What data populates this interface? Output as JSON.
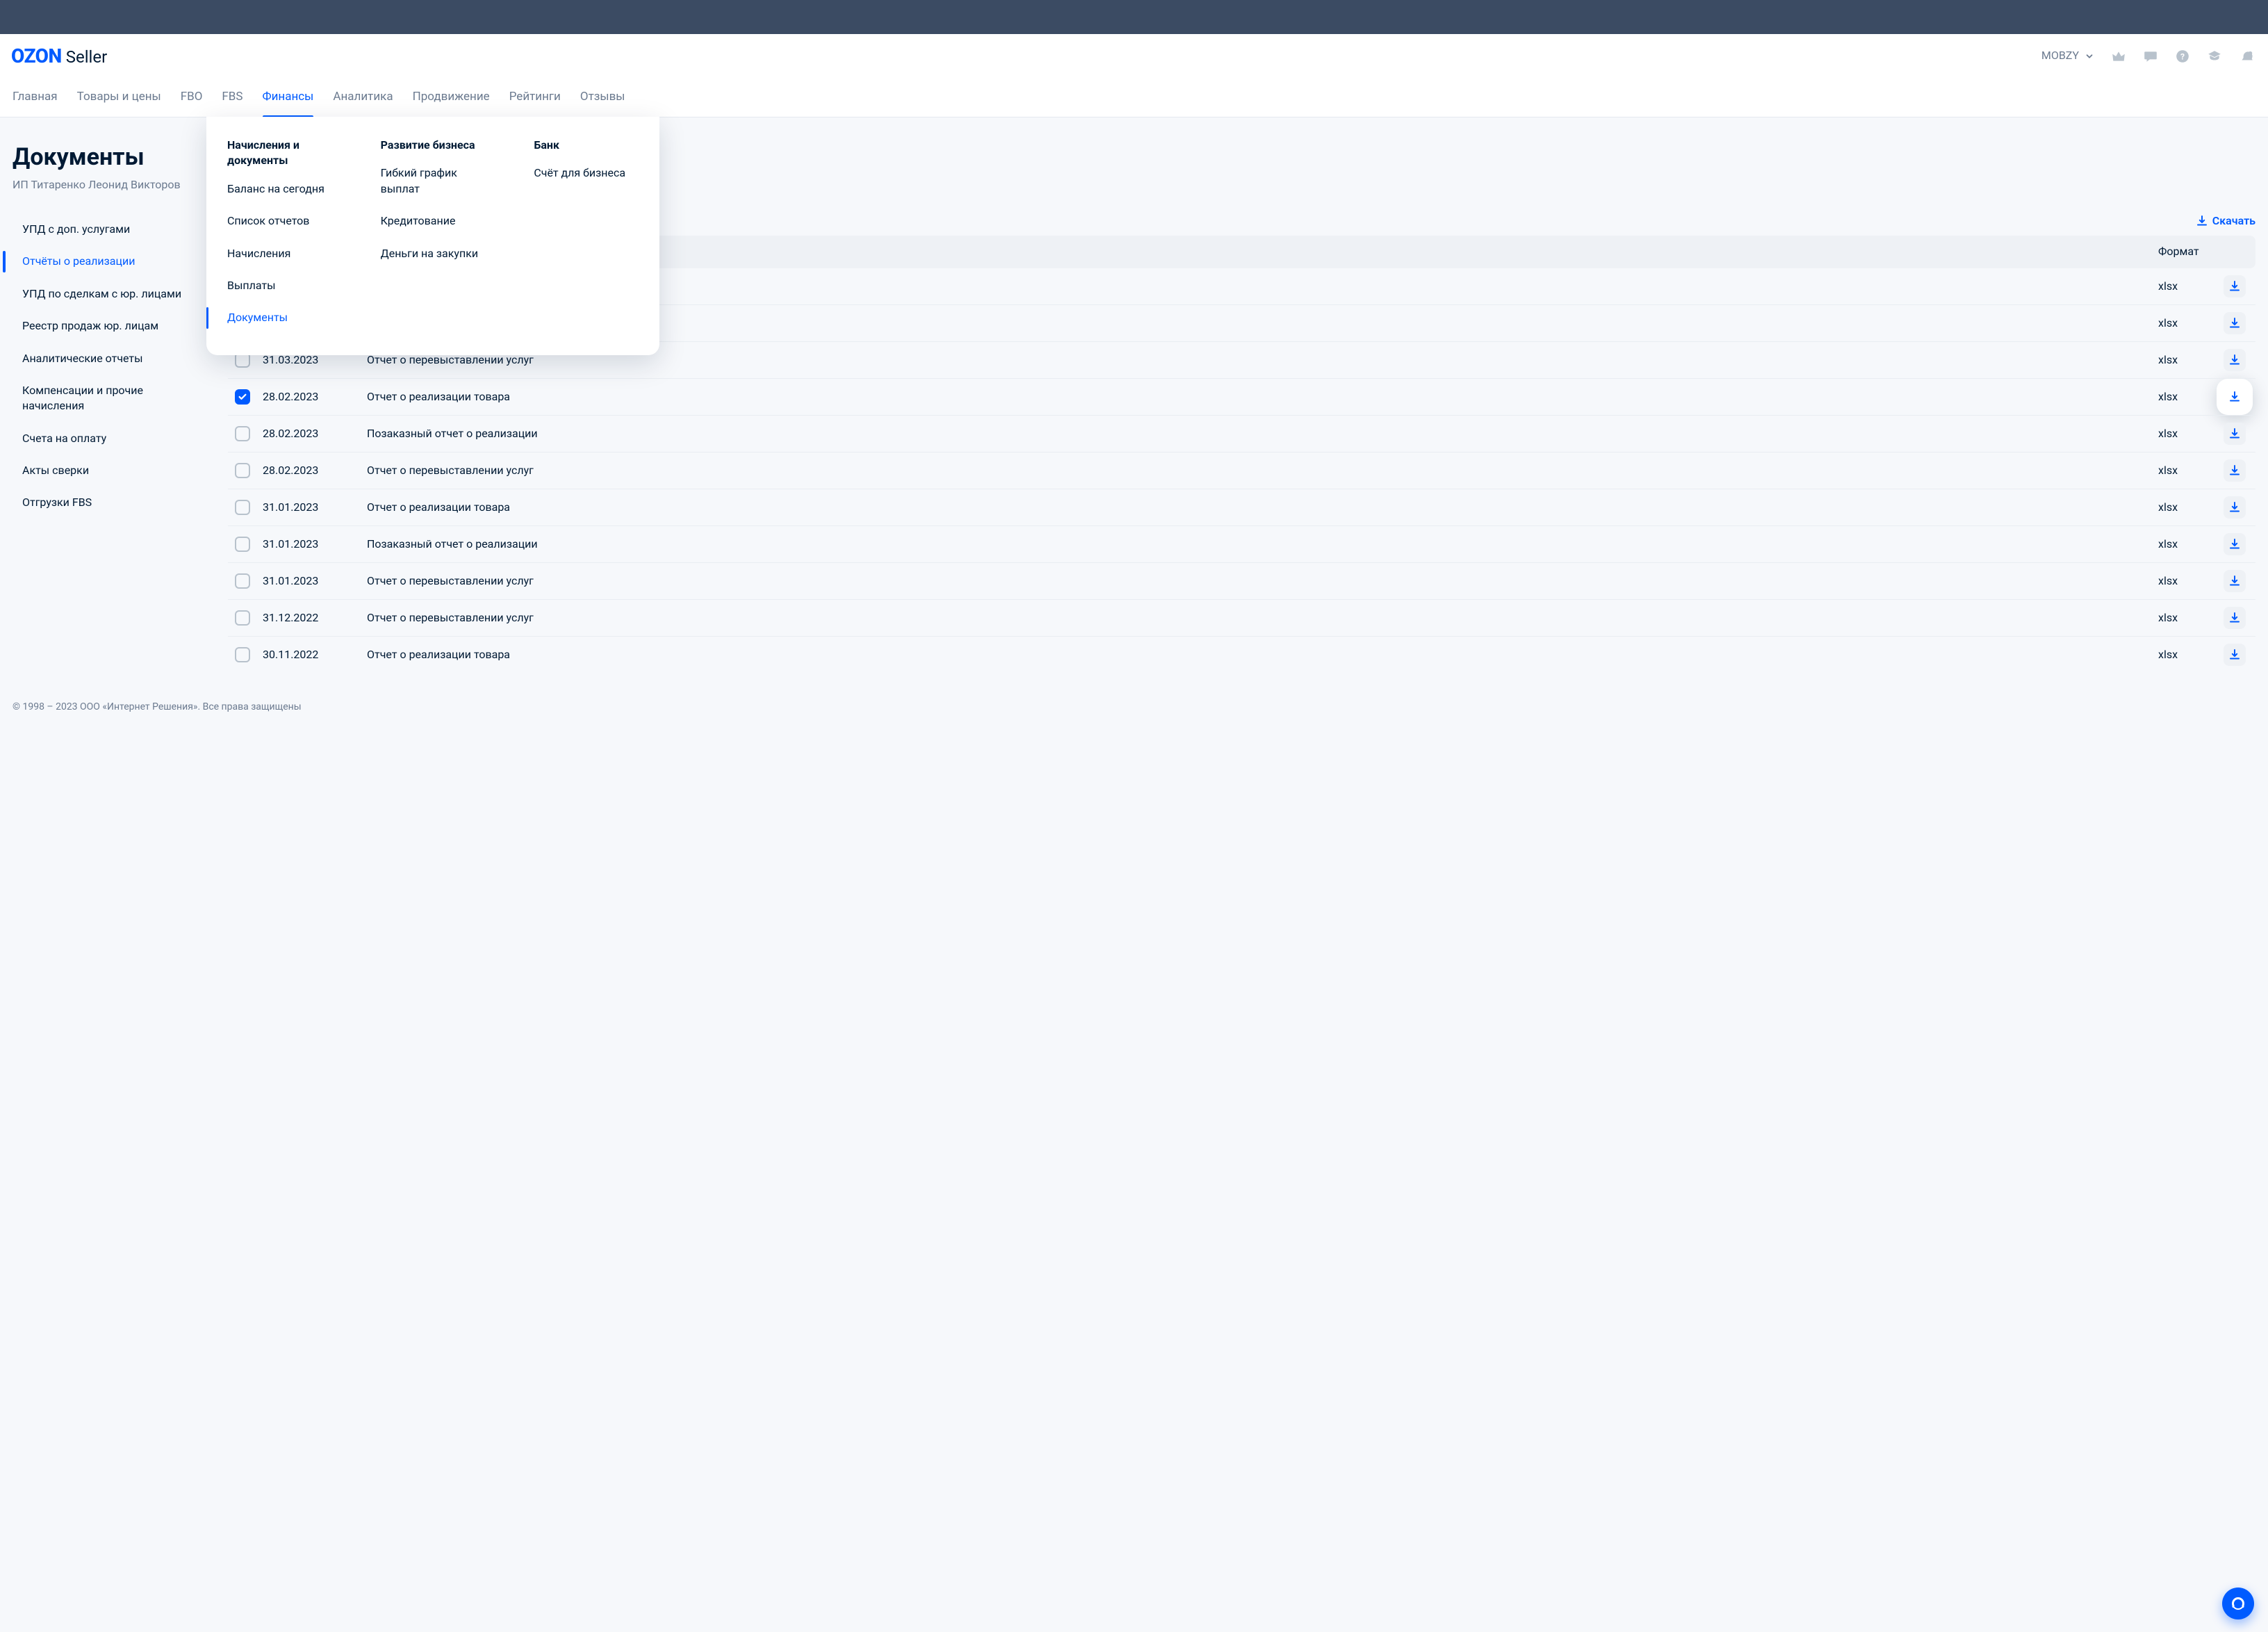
{
  "brand": {
    "main": "OZON",
    "sub": "Seller"
  },
  "account": "MOBZY",
  "nav": [
    {
      "label": "Главная"
    },
    {
      "label": "Товары и цены"
    },
    {
      "label": "FBO"
    },
    {
      "label": "FBS"
    },
    {
      "label": "Финансы",
      "active": true
    },
    {
      "label": "Аналитика"
    },
    {
      "label": "Продвижение"
    },
    {
      "label": "Рейтинги"
    },
    {
      "label": "Отзывы"
    }
  ],
  "mega": {
    "col1head": "Начисления и документы",
    "col1": [
      "Баланс на сегодня",
      "Список отчетов",
      "Начисления",
      "Выплаты",
      "Документы"
    ],
    "col2head": "Развитие бизнеса",
    "col2": [
      "Гибкий график выплат",
      "Кредитование",
      "Деньги на закупки"
    ],
    "col3head": "Банк",
    "col3": [
      "Счёт для бизнеса"
    ]
  },
  "page": {
    "title": "Документы",
    "subtitle": "ИП Титаренко Леонид Викторов"
  },
  "sidebar": [
    "УПД с доп. услугами",
    "Отчёты о реализации",
    "УПД по сделкам с юр. лицами",
    "Реестр продаж юр. лицам",
    "Аналитические отчеты",
    "Компенсации и прочие начисления",
    "Счета на оплату",
    "Акты сверки",
    "Отгрузки FBS"
  ],
  "downloadAll": "Скачать",
  "thead": {
    "format": "Формат"
  },
  "rows": [
    {
      "date": "",
      "name": "",
      "format": "xlsx"
    },
    {
      "date": "",
      "name": "",
      "format": "xlsx"
    },
    {
      "date": "31.03.2023",
      "name": "Отчет о перевыставлении услуг",
      "format": "xlsx"
    },
    {
      "date": "28.02.2023",
      "name": "Отчет о реализации товара",
      "format": "xlsx",
      "checked": true,
      "highlight": true
    },
    {
      "date": "28.02.2023",
      "name": "Позаказный отчет о реализации",
      "format": "xlsx"
    },
    {
      "date": "28.02.2023",
      "name": "Отчет о перевыставлении услуг",
      "format": "xlsx"
    },
    {
      "date": "31.01.2023",
      "name": "Отчет о реализации товара",
      "format": "xlsx"
    },
    {
      "date": "31.01.2023",
      "name": "Позаказный отчет о реализации",
      "format": "xlsx"
    },
    {
      "date": "31.01.2023",
      "name": "Отчет о перевыставлении услуг",
      "format": "xlsx"
    },
    {
      "date": "31.12.2022",
      "name": "Отчет о перевыставлении услуг",
      "format": "xlsx"
    },
    {
      "date": "30.11.2022",
      "name": "Отчет о реализации товара",
      "format": "xlsx"
    }
  ],
  "footer": "© 1998 – 2023 ООО «Интернет Решения». Все права защищены"
}
